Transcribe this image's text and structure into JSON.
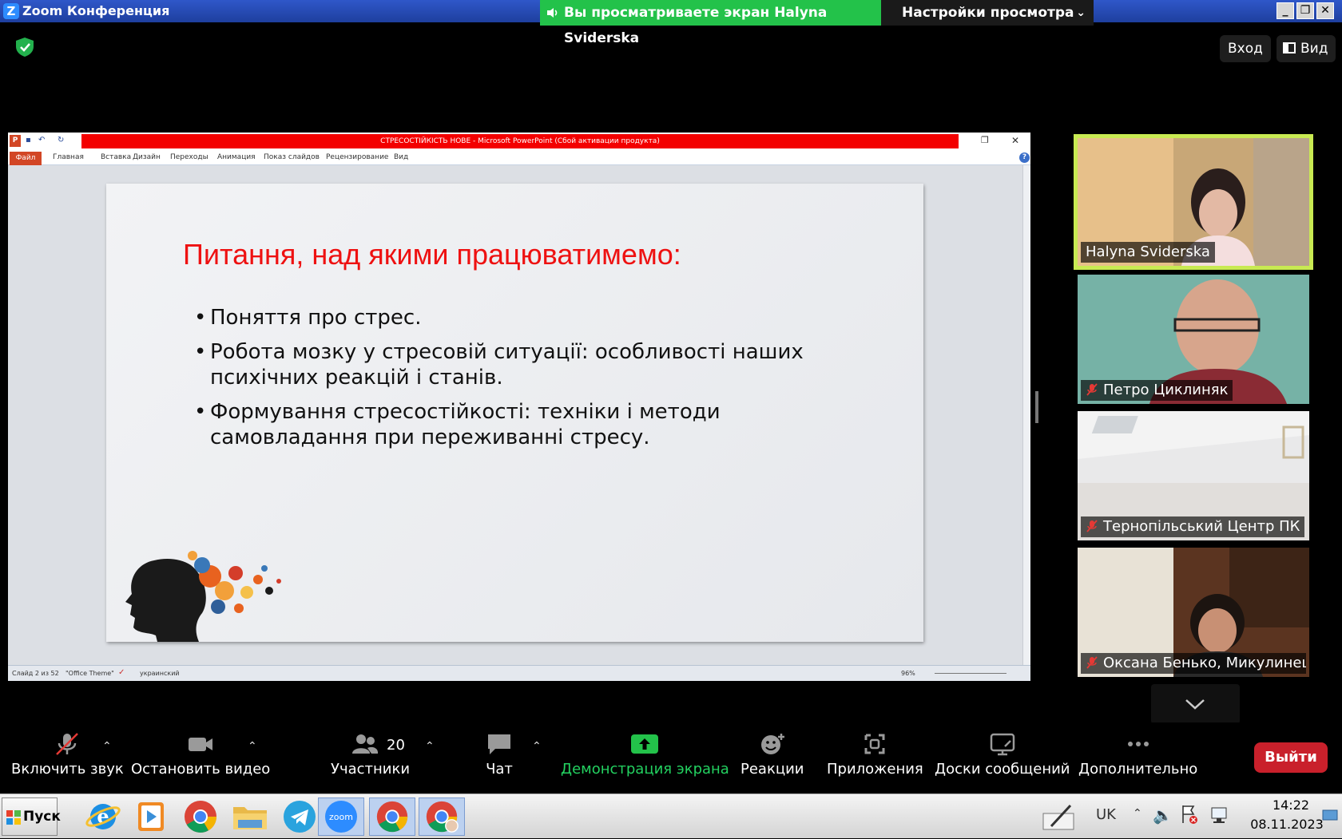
{
  "window": {
    "title": "Zoom Конференция",
    "share_banner": "Вы просматриваете экран Halyna Sviderska",
    "view_settings": "Настройки просмотра"
  },
  "top_controls": {
    "enter": "Вход",
    "view": "Вид"
  },
  "ppt": {
    "title": "СТРЕСОСТІЙКІСТЬ НОВЕ  -  Microsoft PowerPoint (Сбой активации продукта)",
    "tabs": [
      "Файл",
      "Главная",
      "Вставка",
      "Дизайн",
      "Переходы",
      "Анимация",
      "Показ слайдов",
      "Рецензирование",
      "Вид"
    ],
    "status": {
      "slide": "Слайд 2 из 52",
      "theme": "\"Office Theme\"",
      "language": "украинский",
      "zoom": "96%"
    }
  },
  "slide": {
    "title": "Питання, над якими працюватимемо:",
    "bullets": [
      "Поняття про стрес.",
      "Робота мозку у стресовій ситуації: особливості наших психічних реакцій і станів.",
      "Формування стресостійкості: техніки і методи самовладання при переживанні стресу."
    ]
  },
  "participants": [
    {
      "name": "Halyna Sviderska",
      "muted": false,
      "active": true
    },
    {
      "name": "Петро Циклиняк",
      "muted": true
    },
    {
      "name": "Тернопільський Центр ПК",
      "muted": true
    },
    {
      "name": "Оксана Бенько, Микулинец...",
      "muted": true
    }
  ],
  "toolbar": {
    "unmute": "Включить звук",
    "stop_video": "Остановить видео",
    "participants": "Участники",
    "participants_count": "20",
    "chat": "Чат",
    "share": "Демонстрация экрана",
    "reactions": "Реакции",
    "apps": "Приложения",
    "whiteboards": "Доски сообщений",
    "more": "Дополнительно",
    "leave": "Выйти"
  },
  "taskbar": {
    "start": "Пуск",
    "zoom_label": "zoom",
    "lang": "UK",
    "time": "14:22",
    "date": "08.11.2023"
  },
  "colors": {
    "share_green": "#23c24a",
    "active_border": "#c8ea52",
    "leave_red": "#c9202b",
    "slide_title_red": "#ee1111"
  }
}
